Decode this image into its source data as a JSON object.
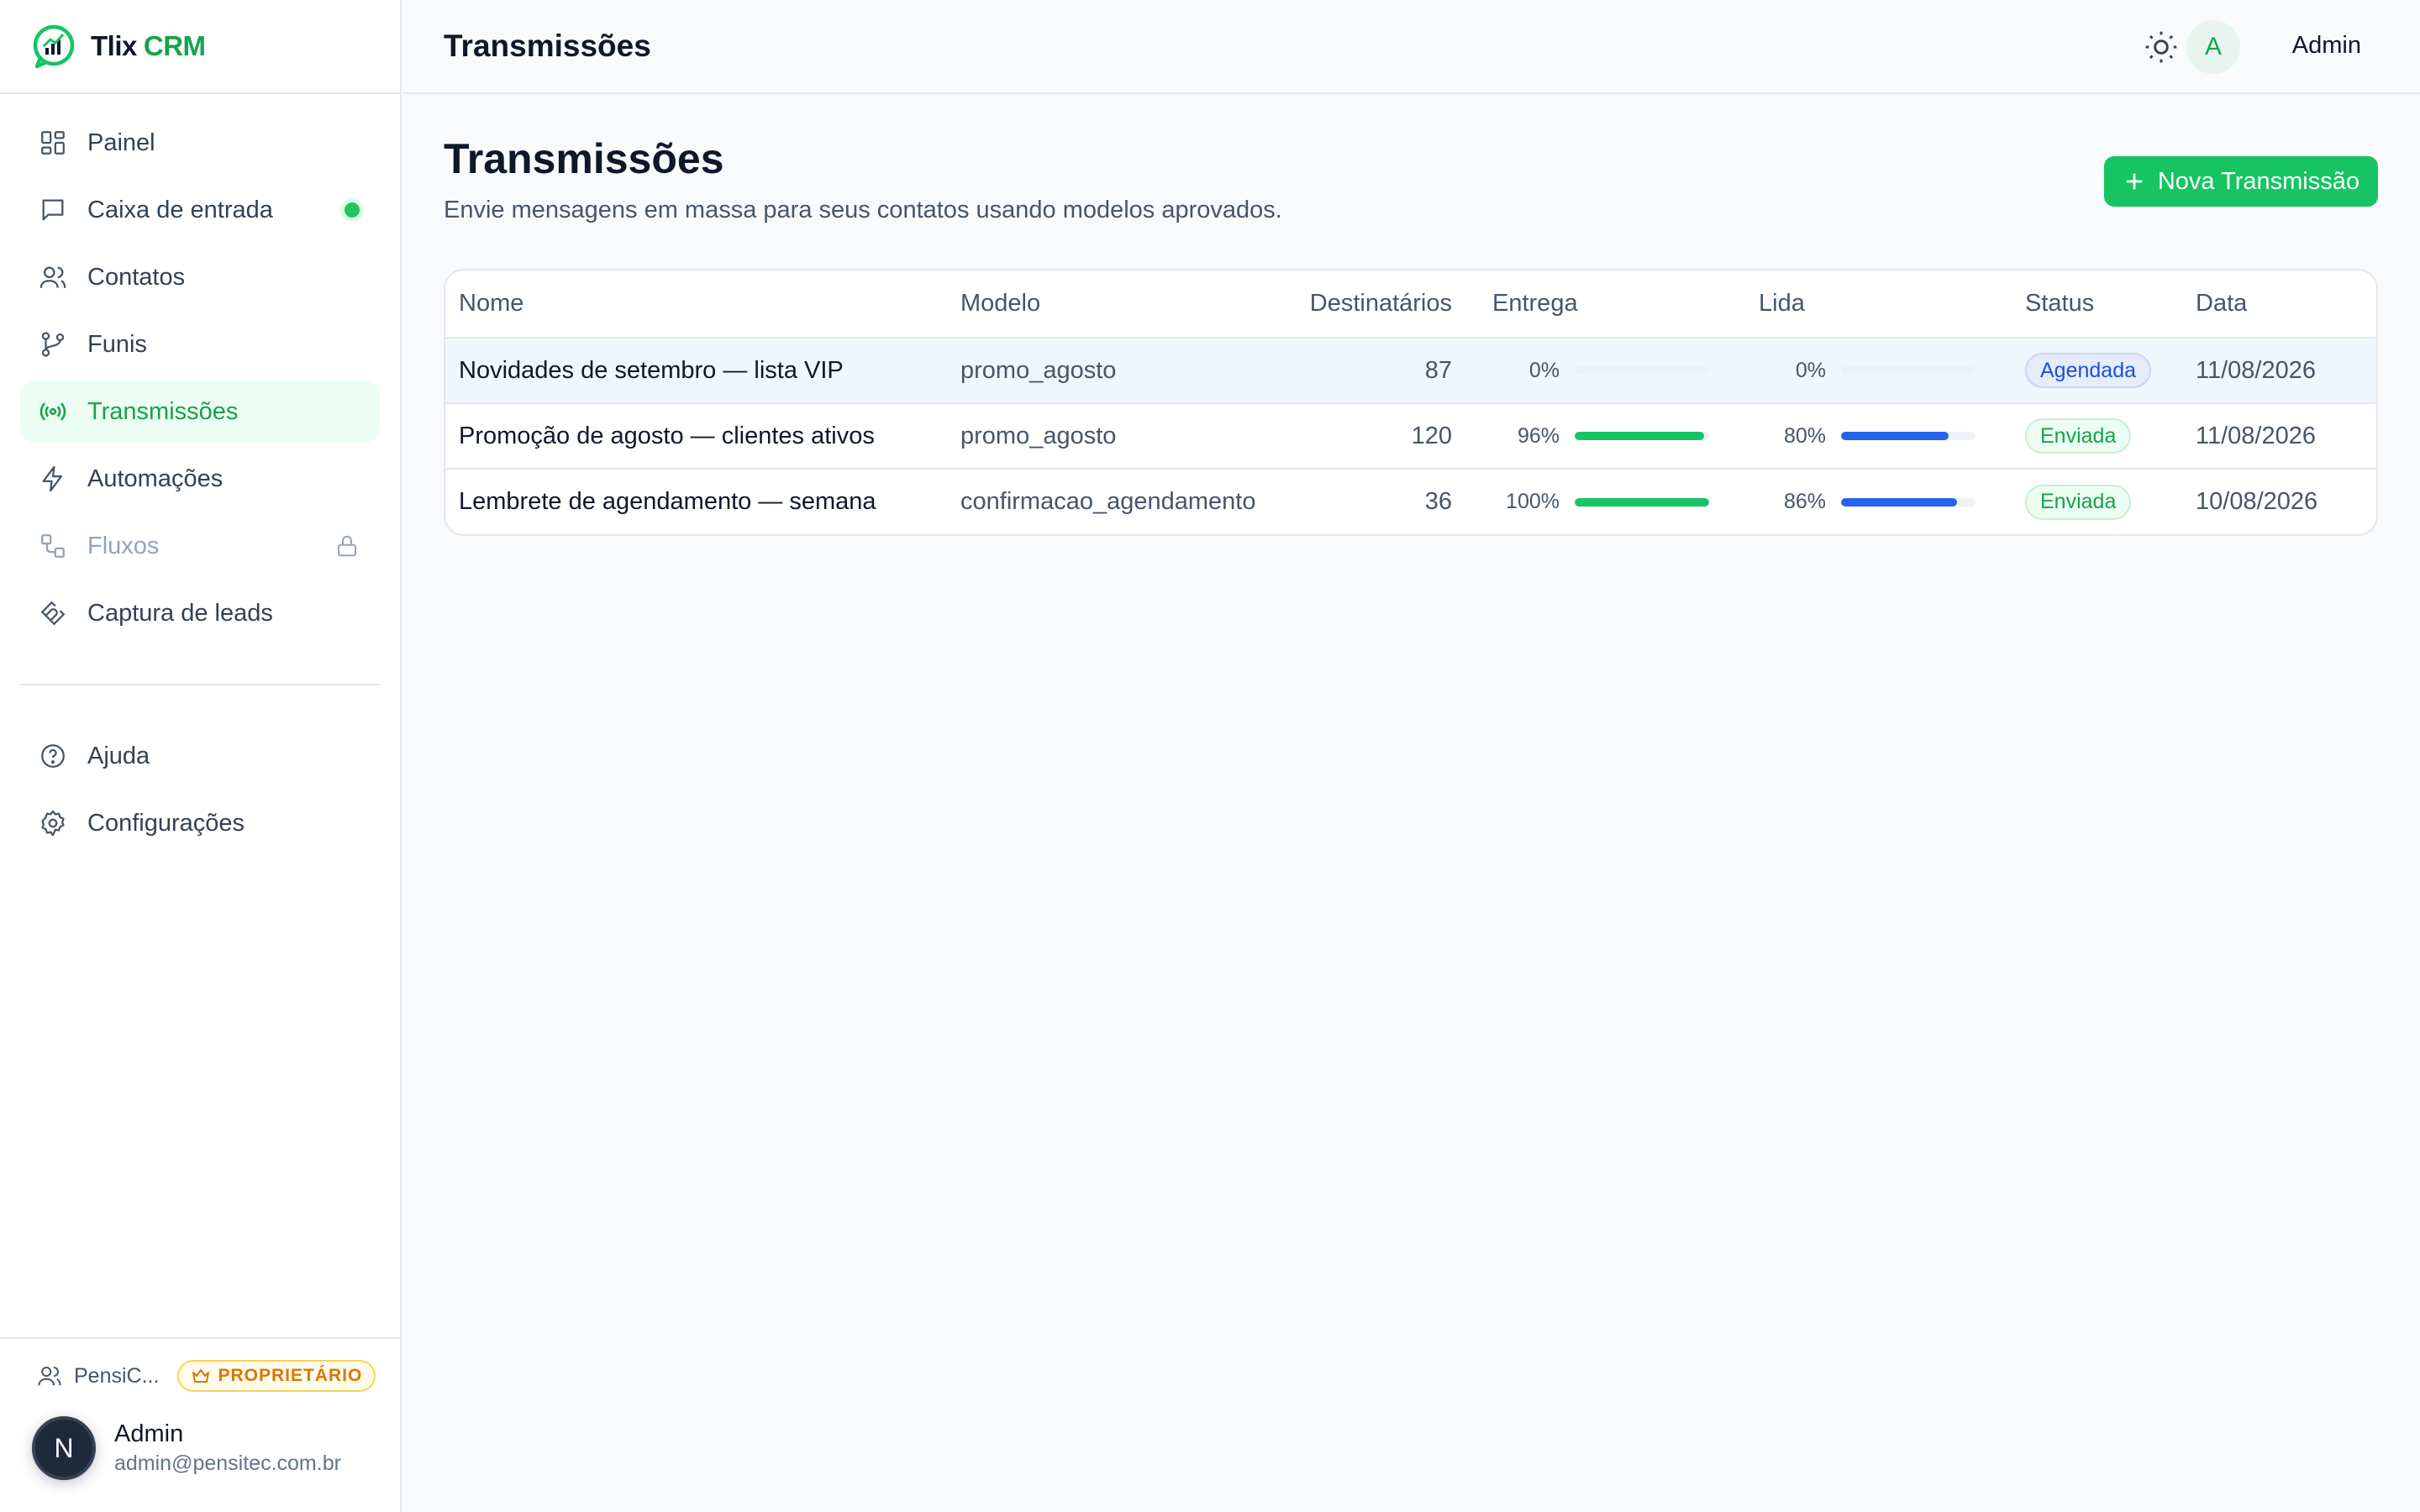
{
  "brand": {
    "name_part1": "Tlix",
    "name_part2": "CRM"
  },
  "sidebar": {
    "items": [
      {
        "label": "Painel",
        "icon": "dashboard-icon"
      },
      {
        "label": "Caixa de entrada",
        "icon": "message-square-icon",
        "has_indicator": true
      },
      {
        "label": "Contatos",
        "icon": "users-icon"
      },
      {
        "label": "Funis",
        "icon": "git-branch-icon"
      },
      {
        "label": "Transmissões",
        "icon": "broadcast-icon",
        "active": true
      },
      {
        "label": "Automações",
        "icon": "zap-icon"
      },
      {
        "label": "Fluxos",
        "icon": "workflow-icon",
        "locked": true
      },
      {
        "label": "Captura de leads",
        "icon": "magnet-icon"
      }
    ],
    "bottom_items": [
      {
        "label": "Ajuda",
        "icon": "help-circle-icon"
      },
      {
        "label": "Configurações",
        "icon": "gear-icon"
      }
    ],
    "footer": {
      "org_name": "PensiC...",
      "role": "PROPRIETÁRIO",
      "avatar_initial": "N",
      "user_name": "Admin",
      "user_email": "admin@pensitec.com.br"
    }
  },
  "header": {
    "title": "Transmissões",
    "avatar_initial": "A",
    "user_name": "Admin"
  },
  "main": {
    "title": "Transmissões",
    "subtitle": "Envie mensagens em massa para seus contatos usando modelos aprovados.",
    "new_button_label": "Nova Transmissão",
    "table": {
      "columns": [
        "Nome",
        "Modelo",
        "Destinatários",
        "Entrega",
        "Lida",
        "Status",
        "Data"
      ],
      "rows": [
        {
          "name": "Novidades de setembro — lista VIP",
          "model": "promo_agosto",
          "recipients": "87",
          "delivery_pct": "0%",
          "delivery_value": 0,
          "read_pct": "0%",
          "read_value": 0,
          "status": "Agendada",
          "status_kind": "scheduled",
          "date": "11/08/2026"
        },
        {
          "name": "Promoção de agosto — clientes ativos",
          "model": "promo_agosto",
          "recipients": "120",
          "delivery_pct": "96%",
          "delivery_value": 96,
          "read_pct": "80%",
          "read_value": 80,
          "status": "Enviada",
          "status_kind": "sent",
          "date": "11/08/2026"
        },
        {
          "name": "Lembrete de agendamento — semana",
          "model": "confirmacao_agendamento",
          "recipients": "36",
          "delivery_pct": "100%",
          "delivery_value": 100,
          "read_pct": "86%",
          "read_value": 86,
          "status": "Enviada",
          "status_kind": "sent",
          "date": "10/08/2026"
        }
      ]
    }
  },
  "colors": {
    "accent": "#16c463",
    "read_bar": "#2563eb",
    "scheduled_badge": "#1d4ed8",
    "sent_badge": "#16a34a",
    "role_badge": "#d97706"
  }
}
